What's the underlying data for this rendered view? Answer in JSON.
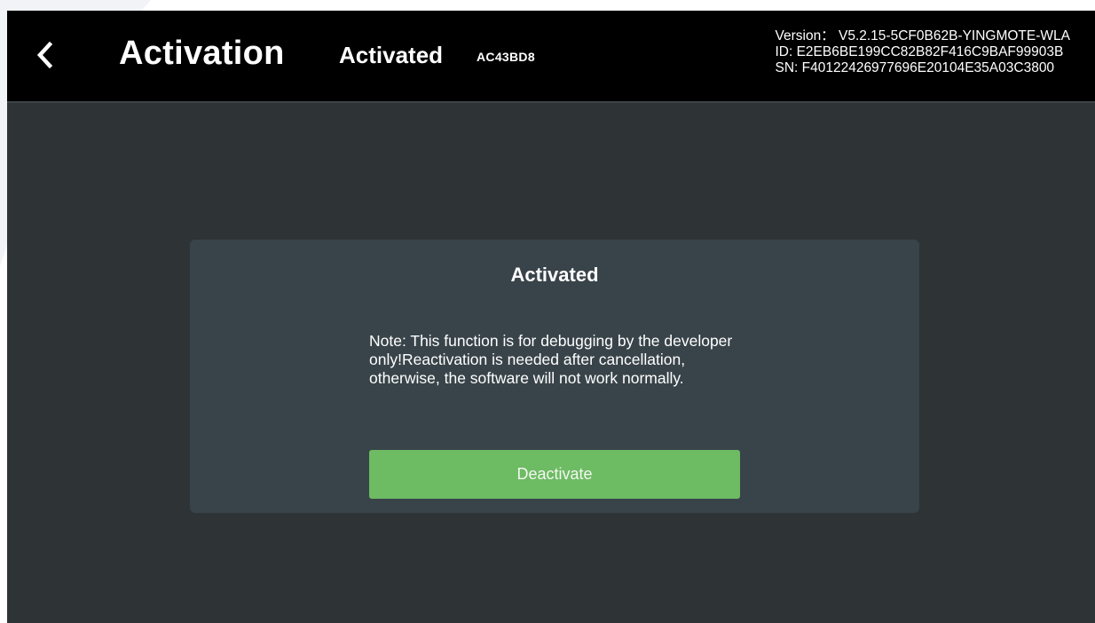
{
  "header": {
    "title": "Activation",
    "status": "Activated",
    "activation_code": "AC43BD8",
    "version_line": "Version： V5.2.15-5CF0B62B-YINGMOTE-WLA",
    "id_line": "ID: E2EB6BE199CC82B82F416C9BAF99903B",
    "sn_line": "SN: F40122426977696E20104E35A03C3800"
  },
  "card": {
    "title": "Activated",
    "note": "Note: This function is for debugging by the developer only!Reactivation is needed after cancellation, otherwise, the software will not work normally.",
    "button_label": "Deactivate"
  },
  "icons": {
    "back": "chevron-left-icon"
  },
  "colors": {
    "header_background": "#000000",
    "screen_background": "#2e3436",
    "card_background": "#39444a",
    "button_background": "#6dbb63",
    "text": "#ffffff"
  }
}
